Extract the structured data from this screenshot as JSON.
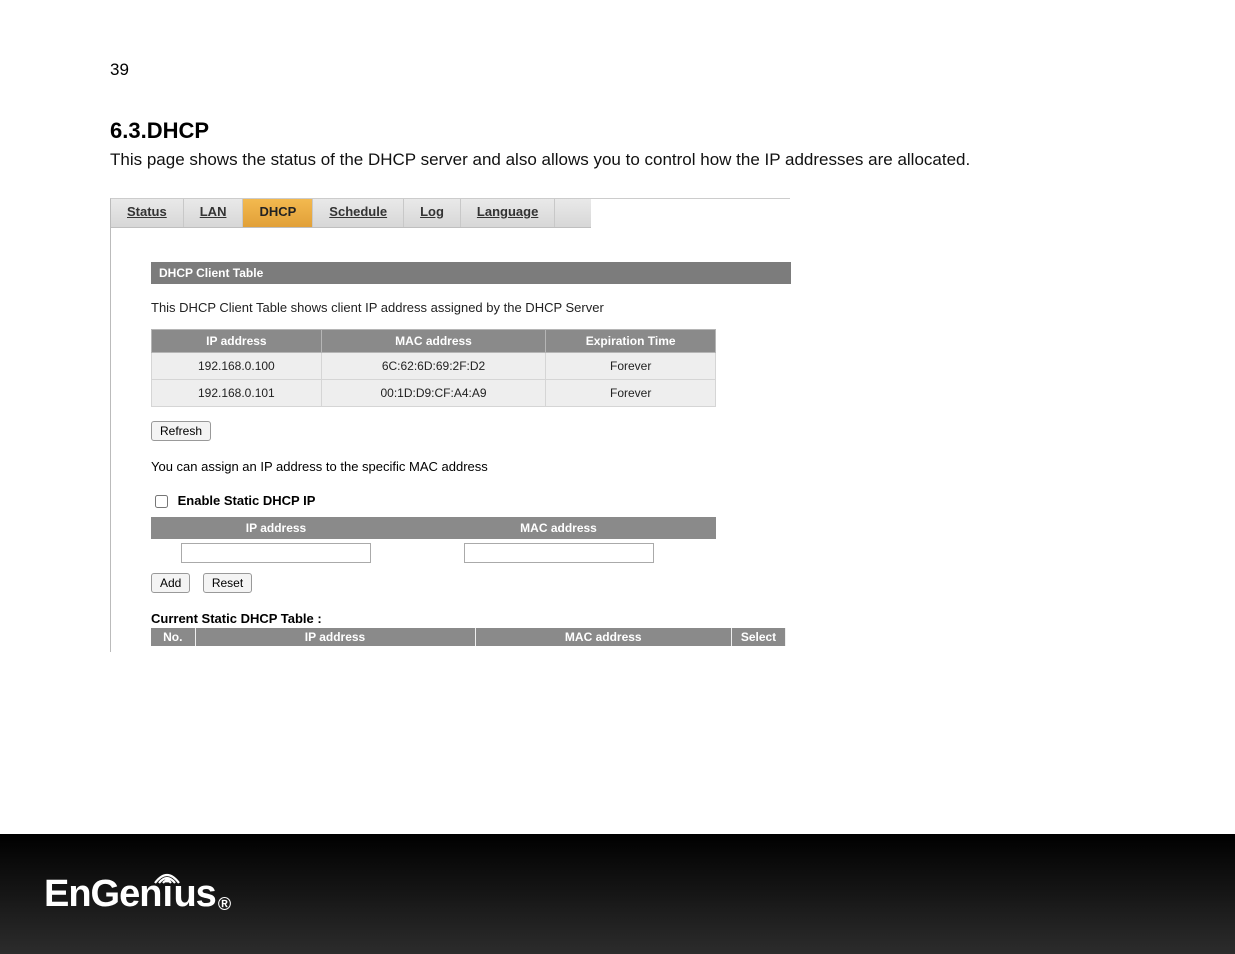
{
  "page_number": "39",
  "section_number": "6.3.",
  "section_title": "DHCP",
  "intro": "This page shows the status of the DHCP server and also allows you to control how the IP addresses are allocated.",
  "tabs": {
    "status": "Status",
    "lan": "LAN",
    "dhcp": "DHCP",
    "schedule": "Schedule",
    "log": "Log",
    "language": "Language"
  },
  "panel_header": "DHCP Client Table",
  "client_desc": "This DHCP Client Table shows client IP address assigned by the DHCP Server",
  "client_headers": {
    "ip": "IP address",
    "mac": "MAC address",
    "exp": "Expiration Time"
  },
  "client_rows": [
    {
      "ip": "192.168.0.100",
      "mac": "6C:62:6D:69:2F:D2",
      "exp": "Forever"
    },
    {
      "ip": "192.168.0.101",
      "mac": "00:1D:D9:CF:A4:A9",
      "exp": "Forever"
    }
  ],
  "refresh_label": "Refresh",
  "assign_desc": "You can assign an IP address to the specific MAC address",
  "enable_static_label": "Enable Static DHCP IP",
  "static_input_headers": {
    "ip": "IP address",
    "mac": "MAC address"
  },
  "add_label": "Add",
  "reset_label": "Reset",
  "current_static_title": "Current Static DHCP Table :",
  "static_list_headers": {
    "no": "No.",
    "ip": "IP address",
    "mac": "MAC address",
    "select": "Select"
  },
  "logo_text_a": "EnGen",
  "logo_text_b": "us",
  "logo_reg": "®"
}
